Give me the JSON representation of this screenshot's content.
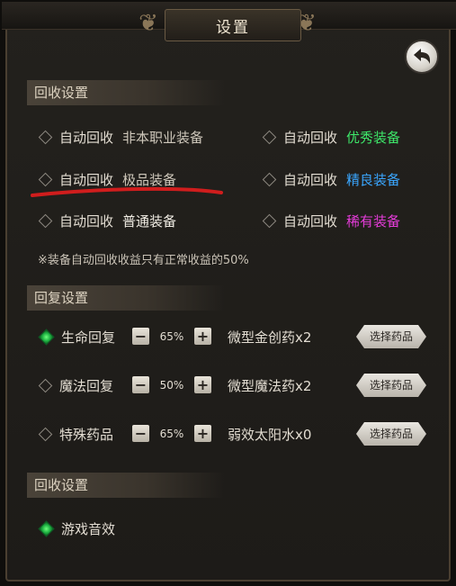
{
  "title": "设置",
  "sections": {
    "recycle": "回收设置",
    "recover": "回复设置",
    "other": "回收设置"
  },
  "recycle_options": [
    {
      "label": "自动回收",
      "quality": "非本职业装备",
      "color": "#cfc8bb",
      "checked": false
    },
    {
      "label": "自动回收",
      "quality": "优秀装备",
      "color": "#3ee86a",
      "checked": false
    },
    {
      "label": "自动回收",
      "quality": "极品装备",
      "color": "#cfc8bb",
      "checked": false
    },
    {
      "label": "自动回收",
      "quality": "精良装备",
      "color": "#3aa6ff",
      "checked": false
    },
    {
      "label": "自动回收",
      "quality": "普通装备",
      "color": "#f1ede4",
      "checked": false
    },
    {
      "label": "自动回收",
      "quality": "稀有装备",
      "color": "#e53cd9",
      "checked": false
    }
  ],
  "note": "※装备自动回收收益只有正常收益的50%",
  "recover_rows": [
    {
      "label": "生命回复",
      "percent": "65%",
      "medicine": "微型金创药x2",
      "button": "选择药品",
      "checked": true
    },
    {
      "label": "魔法回复",
      "percent": "50%",
      "medicine": "微型魔法药x2",
      "button": "选择药品",
      "checked": false
    },
    {
      "label": "特殊药品",
      "percent": "65%",
      "medicine": "弱效太阳水x0",
      "button": "选择药品",
      "checked": false
    }
  ],
  "sound": {
    "label": "游戏音效",
    "checked": true
  },
  "stepper": {
    "minus": "−",
    "plus": "+"
  },
  "icons": {
    "back": "back-arrow-icon",
    "scroll": "ornament-scroll-icon"
  },
  "colors": {
    "annotation": "#d01d1d"
  }
}
